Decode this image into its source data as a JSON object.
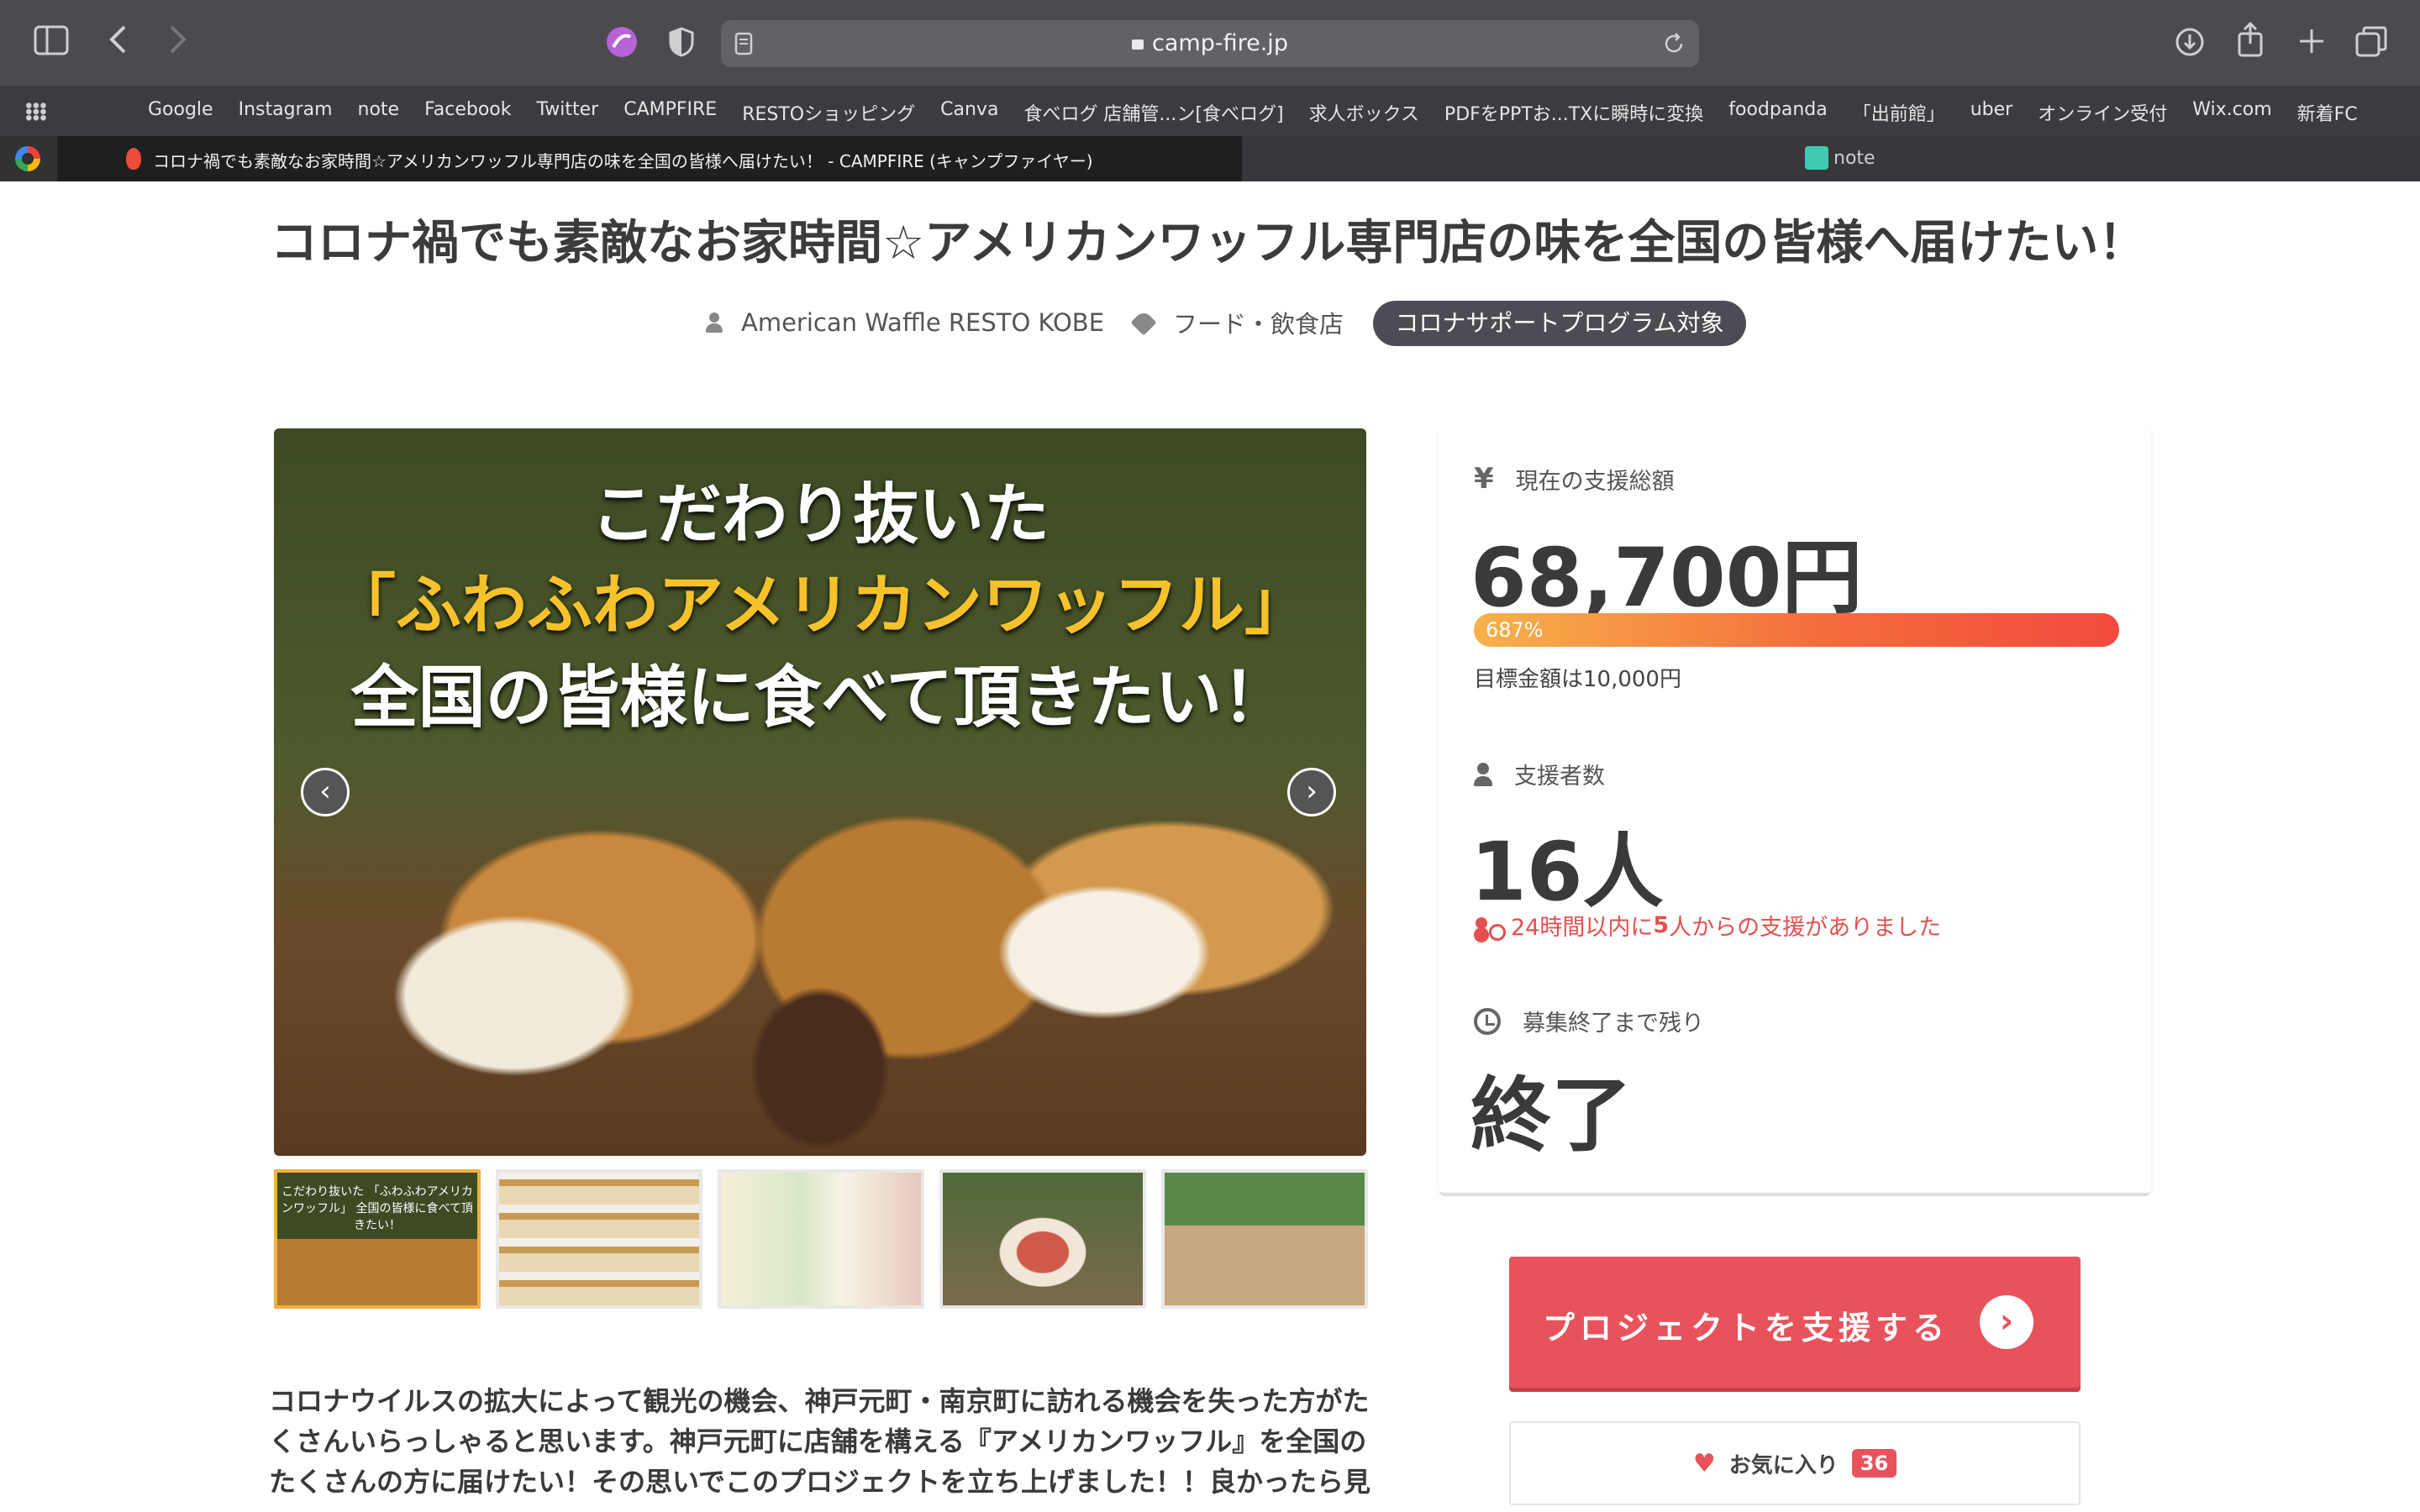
{
  "browser": {
    "url": "camp-fire.jp",
    "bookmarks": [
      "Google",
      "Instagram",
      "note",
      "Facebook",
      "Twitter",
      "CAMPFIRE",
      "RESTOショッピング",
      "Canva",
      "食べログ 店舗管...ン[食べログ]",
      "求人ボックス",
      "PDFをPPTお...TXに瞬時に変換",
      "foodpanda",
      "「出前館」",
      "uber",
      "オンライン受付",
      "Wix.com",
      "新着FC"
    ],
    "tabs": {
      "active": "コロナ禍でも素敵なお家時間☆アメリカンワッフル専門店の味を全国の皆様へ届けたい！ - CAMPFIRE (キャンプファイヤー)",
      "other": "note"
    }
  },
  "project": {
    "title": "コロナ禍でも素敵なお家時間☆アメリカンワッフル専門店の味を全国の皆様へ届けたい！",
    "owner": "American Waffle RESTO KOBE",
    "category": "フード・飲食店",
    "badge": "コロナサポートプログラム対象",
    "hero": {
      "line1": "こだわり抜いた",
      "line2": "「ふわふわアメリカンワッフル」",
      "line3": "全国の皆様に食べて頂きたい！"
    },
    "thumb1_text": "こだわり抜いた 「ふわふわアメリカンワッフル」 全国の皆様に食べて頂きたい！",
    "intro": "コロナウイルスの拡大によって観光の機会、神戸元町・南京町に訪れる機会を失った方がたくさんいらっしゃると思います。神戸元町に店舗を構える『アメリカンワッフル』を全国のたくさんの方に届けたい！その思いでこのプロジェクトを立ち上げました！！良かったら見"
  },
  "stats": {
    "amount_label": "現在の支援総額",
    "amount": "68,700円",
    "progress_text": "687%",
    "progress_ratio": 1.0,
    "goal": "目標金額は10,000円",
    "backers_label": "支援者数",
    "backers": "16人",
    "recent_pre": "24時間以内に",
    "recent_count": "5",
    "recent_post": "人からの支援がありました",
    "remaining_label": "募集終了まで残り",
    "remaining": "終了"
  },
  "actions": {
    "support": "プロジェクトを支援する",
    "favorite": "お気に入り",
    "favorite_count": "36"
  },
  "icons": {
    "back": "chevron-left-icon",
    "forward": "chevron-right-icon",
    "share": "share-icon"
  },
  "colors": {
    "accent": "#e8525c",
    "badge": "#4c4c54"
  }
}
